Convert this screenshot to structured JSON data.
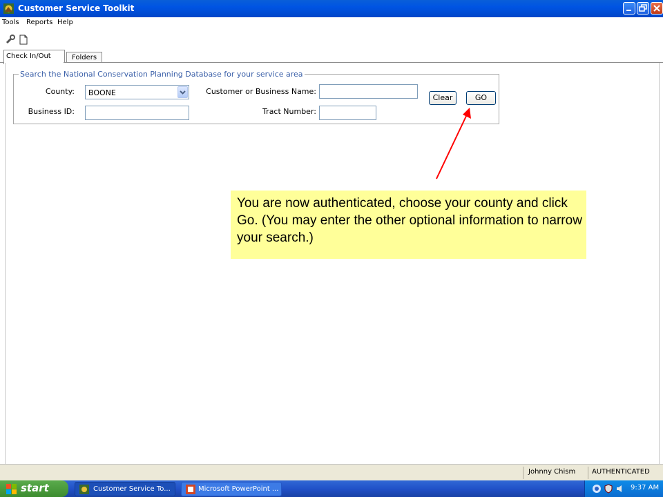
{
  "window": {
    "title": "Customer Service Toolkit"
  },
  "menu": [
    "Tools",
    "Reports",
    "Help"
  ],
  "toolbar": {
    "icons": [
      "wrench-icon",
      "new-document-icon"
    ]
  },
  "tabs": [
    {
      "label": "Check In/Out",
      "active": true
    },
    {
      "label": "Folders",
      "active": false
    }
  ],
  "search": {
    "legend": "Search the National Conservation Planning Database for your service area",
    "county_label": "County:",
    "county_value": "BOONE",
    "business_id_label": "Business ID:",
    "business_id_value": "",
    "customer_label": "Customer or Business Name:",
    "customer_value": "",
    "tract_label": "Tract Number:",
    "tract_value": "",
    "clear_label": "Clear",
    "go_label": "GO"
  },
  "callout": {
    "text": "You are now authenticated, choose your county and click Go. (You may enter the other optional information to narrow your search.)",
    "arrow_color": "#ff0000",
    "background_color": "#ffff99"
  },
  "status": {
    "user": "Johnny Chism",
    "state": "AUTHENTICATED"
  },
  "taskbar": {
    "start_label": "start",
    "tasks": [
      "Customer Service To...",
      "Microsoft PowerPoint ..."
    ],
    "clock": "9:37 AM"
  }
}
